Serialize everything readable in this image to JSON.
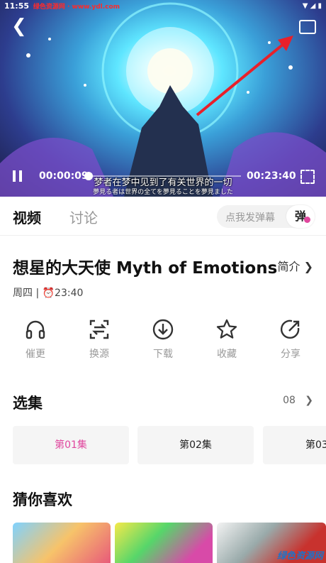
{
  "status": {
    "time": "11:55",
    "watermark": "绿色资源网 · www.ydl.com"
  },
  "player": {
    "current_time": "00:00:09",
    "total_time": "00:23:40",
    "progress": 0.006,
    "subtitle_cn": "梦者在梦中见到了有关世界的一切",
    "subtitle_jp": "夢見る者は世界の全てを夢見ることを夢見ました"
  },
  "tabs": {
    "video": "视频",
    "discuss": "讨论"
  },
  "danmaku": {
    "placeholder": "点我发弹幕",
    "button": "弹"
  },
  "show": {
    "title": "想星的大天使 Myth of Emotions",
    "intro": "简介",
    "schedule": "周四 | ⏰23:40"
  },
  "actions": [
    {
      "label": "催更",
      "icon": "headphones-icon"
    },
    {
      "label": "换源",
      "icon": "switch-source-icon"
    },
    {
      "label": "下载",
      "icon": "download-icon"
    },
    {
      "label": "收藏",
      "icon": "star-icon"
    },
    {
      "label": "分享",
      "icon": "share-icon"
    }
  ],
  "episodes": {
    "heading": "选集",
    "count": "08",
    "items": [
      "第01集",
      "第02集",
      "第03"
    ],
    "active_color": "#e0479e"
  },
  "recommend": {
    "heading": "猜你喜欢"
  },
  "site_watermark": "绿色资源网"
}
